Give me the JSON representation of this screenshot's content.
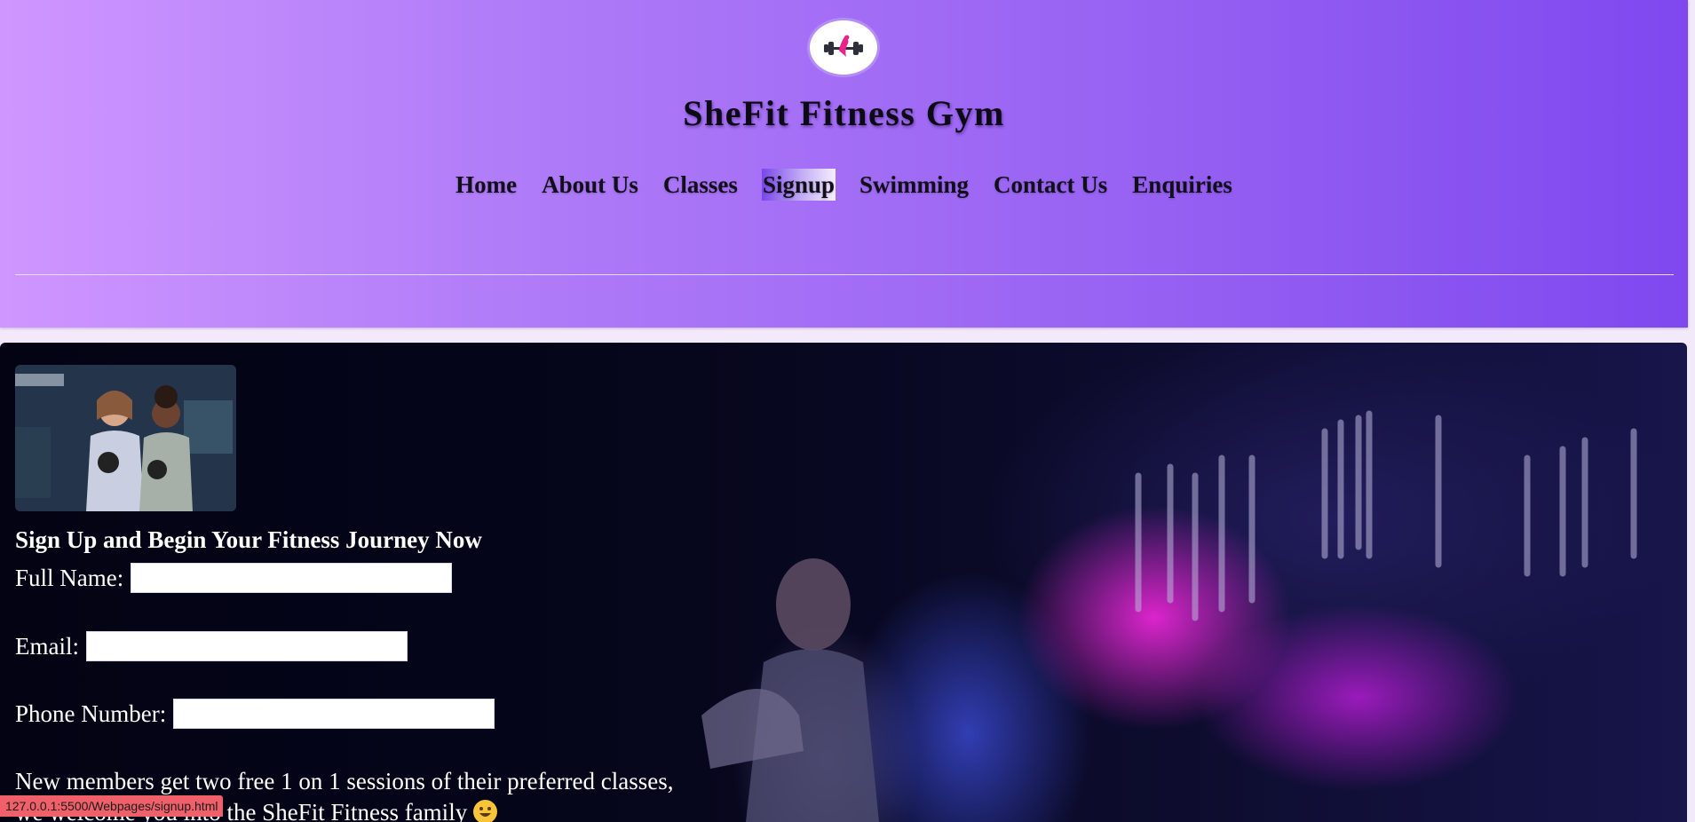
{
  "header": {
    "title": "SheFit Fitness Gym",
    "logo_icon": "dumbbell-figure-logo-icon",
    "nav": [
      {
        "label": "Home",
        "active": false
      },
      {
        "label": "About Us",
        "active": false
      },
      {
        "label": "Classes",
        "active": false
      },
      {
        "label": "Signup",
        "active": true
      },
      {
        "label": "Swimming",
        "active": false
      },
      {
        "label": "Contact Us",
        "active": false
      },
      {
        "label": "Enquiries",
        "active": false
      }
    ]
  },
  "main": {
    "heading": "Sign Up and Begin Your Fitness Journey Now",
    "form": {
      "full_name_label": "Full Name:",
      "full_name_value": "",
      "email_label": "Email:",
      "email_value": "",
      "phone_label": "Phone Number:",
      "phone_value": ""
    },
    "promo_line1": "New members get two free 1 on 1 sessions of their preferred classes,",
    "promo_line2": "we welcome you into the SheFit Fitness family",
    "promo_emoji": "grinning-face-icon"
  },
  "status_bar": {
    "url": "127.0.0.1:5500/Webpages/signup.html"
  },
  "colors": {
    "header_gradient_start": "#cf96ff",
    "header_gradient_end": "#7f48ef",
    "logo_accent": "#e8238a",
    "main_background": "#06061c",
    "status_bar": "#f0606a"
  }
}
